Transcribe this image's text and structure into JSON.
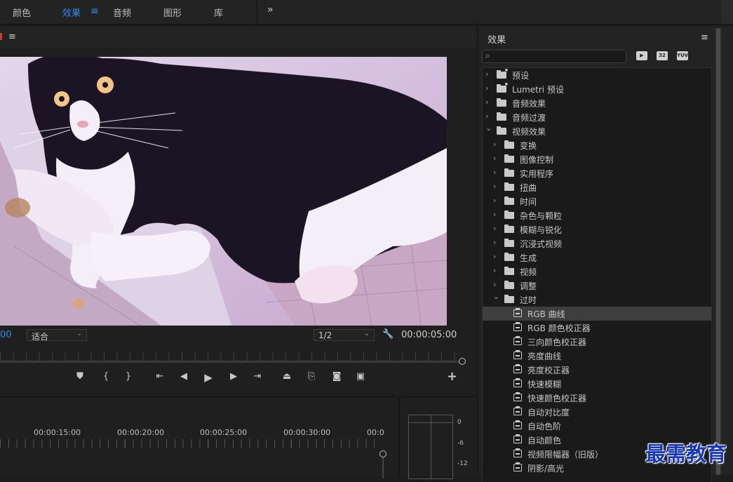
{
  "workspace_tabs": [
    {
      "label": "颜色",
      "active": false
    },
    {
      "label": "效果",
      "active": true
    },
    {
      "label": "音频",
      "active": false
    },
    {
      "label": "图形",
      "active": false
    },
    {
      "label": "库",
      "active": false
    }
  ],
  "workspace_menu_icon": "hamburger-icon",
  "workspace_more_icon": "double-chevron-right-icon",
  "accent_color": "#2d8ceb",
  "program_monitor": {
    "timecode_left": "00",
    "fit_dropdown": "适合",
    "resolution_dropdown": "1/2",
    "timecode_right": "00:00:05:00",
    "transport_icons": [
      "marker-icon",
      "mark-in-icon",
      "mark-out-icon",
      "go-to-in-icon",
      "step-back-icon",
      "play-icon",
      "step-forward-icon",
      "go-to-out-icon",
      "lift-icon",
      "extract-icon",
      "camera-icon",
      "compare-icon",
      "plus-icon"
    ]
  },
  "timeline": {
    "timecodes": [
      "00:00:15:00",
      "00:00:20:00",
      "00:00:25:00",
      "00:00:30:00",
      "00:0"
    ]
  },
  "audio_meter": {
    "scale": [
      "0",
      "-6",
      "-12"
    ]
  },
  "effects_panel": {
    "title": "效果",
    "search_placeholder": "",
    "badges": [
      "accelerated-effects-icon",
      "32",
      "YUV"
    ],
    "items": [
      {
        "label": "预设",
        "level": 0,
        "type": "folder",
        "expanded": false,
        "special": true
      },
      {
        "label": "Lumetri 预设",
        "level": 0,
        "type": "folder",
        "expanded": false,
        "special": true
      },
      {
        "label": "音频效果",
        "level": 0,
        "type": "folder",
        "expanded": false
      },
      {
        "label": "音频过渡",
        "level": 0,
        "type": "folder",
        "expanded": false
      },
      {
        "label": "视频效果",
        "level": 0,
        "type": "folder",
        "expanded": true
      },
      {
        "label": "变换",
        "level": 1,
        "type": "folder",
        "expanded": false
      },
      {
        "label": "图像控制",
        "level": 1,
        "type": "folder",
        "expanded": false
      },
      {
        "label": "实用程序",
        "level": 1,
        "type": "folder",
        "expanded": false
      },
      {
        "label": "扭曲",
        "level": 1,
        "type": "folder",
        "expanded": false
      },
      {
        "label": "时间",
        "level": 1,
        "type": "folder",
        "expanded": false
      },
      {
        "label": "杂色与颗粒",
        "level": 1,
        "type": "folder",
        "expanded": false
      },
      {
        "label": "模糊与锐化",
        "level": 1,
        "type": "folder",
        "expanded": false
      },
      {
        "label": "沉浸式视频",
        "level": 1,
        "type": "folder",
        "expanded": false
      },
      {
        "label": "生成",
        "level": 1,
        "type": "folder",
        "expanded": false
      },
      {
        "label": "视频",
        "level": 1,
        "type": "folder",
        "expanded": false
      },
      {
        "label": "调整",
        "level": 1,
        "type": "folder",
        "expanded": false
      },
      {
        "label": "过时",
        "level": 1,
        "type": "folder",
        "expanded": true
      },
      {
        "label": "RGB 曲线",
        "level": 2,
        "type": "effect",
        "selected": true
      },
      {
        "label": "RGB 颜色校正器",
        "level": 2,
        "type": "effect"
      },
      {
        "label": "三向颜色校正器",
        "level": 2,
        "type": "effect"
      },
      {
        "label": "亮度曲线",
        "level": 2,
        "type": "effect"
      },
      {
        "label": "亮度校正器",
        "level": 2,
        "type": "effect"
      },
      {
        "label": "快速模糊",
        "level": 2,
        "type": "effect"
      },
      {
        "label": "快速颜色校正器",
        "level": 2,
        "type": "effect"
      },
      {
        "label": "自动对比度",
        "level": 2,
        "type": "effect"
      },
      {
        "label": "自动色阶",
        "level": 2,
        "type": "effect"
      },
      {
        "label": "自动颜色",
        "level": 2,
        "type": "effect"
      },
      {
        "label": "视频限幅器（旧版）",
        "level": 2,
        "type": "effect"
      },
      {
        "label": "阴影/高光",
        "level": 2,
        "type": "effect"
      }
    ]
  },
  "watermark": "最需教育"
}
